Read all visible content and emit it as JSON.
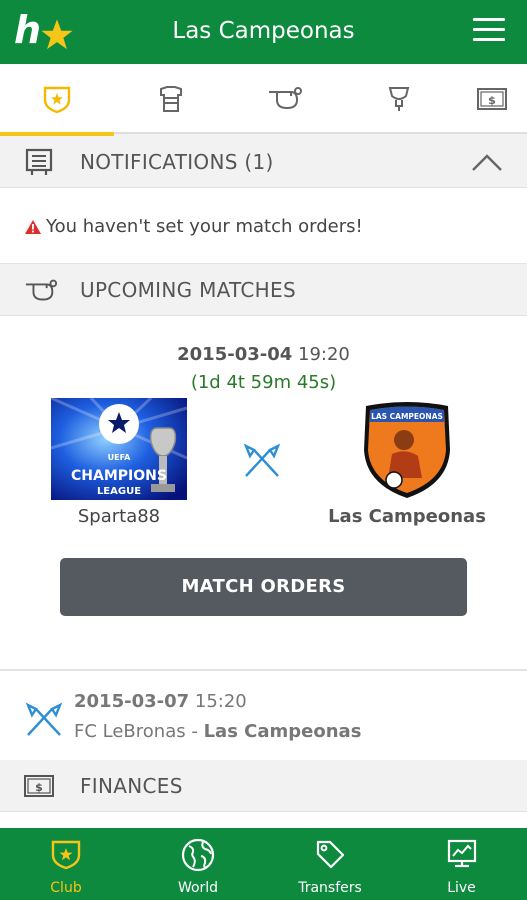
{
  "header": {
    "title": "Las Campeonas",
    "logo_letter": "h"
  },
  "tabs": [
    {
      "icon": "club-badge-icon",
      "active": true
    },
    {
      "icon": "jersey-icon",
      "active": false
    },
    {
      "icon": "whistle-icon",
      "active": false
    },
    {
      "icon": "trophy-icon",
      "active": false
    },
    {
      "icon": "money-icon",
      "active": false
    }
  ],
  "notifications": {
    "title": "NOTIFICATIONS (1)",
    "message": "You haven't set your match orders!"
  },
  "upcoming": {
    "title": "UPCOMING MATCHES",
    "featured": {
      "date": "2015-03-04",
      "time": "19:20",
      "countdown": "(1d 4t 59m 45s)",
      "home_team": "Sparta88",
      "home_crest_text": [
        "UEFA",
        "CHAMPIONS",
        "LEAGUE"
      ],
      "away_team": "Las Campeonas",
      "away_crest_text": "LAS CAMPEONAS",
      "orders_button": "MATCH ORDERS"
    },
    "next": {
      "date": "2015-03-07",
      "time": "15:20",
      "home_team": "FC LeBronas",
      "separator": " - ",
      "away_team": "Las Campeonas"
    }
  },
  "finances": {
    "title": "FINANCES"
  },
  "bottom_nav": [
    {
      "label": "Club",
      "icon": "club-badge-icon",
      "active": true
    },
    {
      "label": "World",
      "icon": "globe-icon",
      "active": false
    },
    {
      "label": "Transfers",
      "icon": "tag-icon",
      "active": false
    },
    {
      "label": "Live",
      "icon": "tv-chart-icon",
      "active": false
    }
  ],
  "colors": {
    "brand_green": "#0d8a3e",
    "accent_yellow": "#f5c518",
    "warning_red": "#d9302c",
    "button_gray": "#555a60"
  }
}
